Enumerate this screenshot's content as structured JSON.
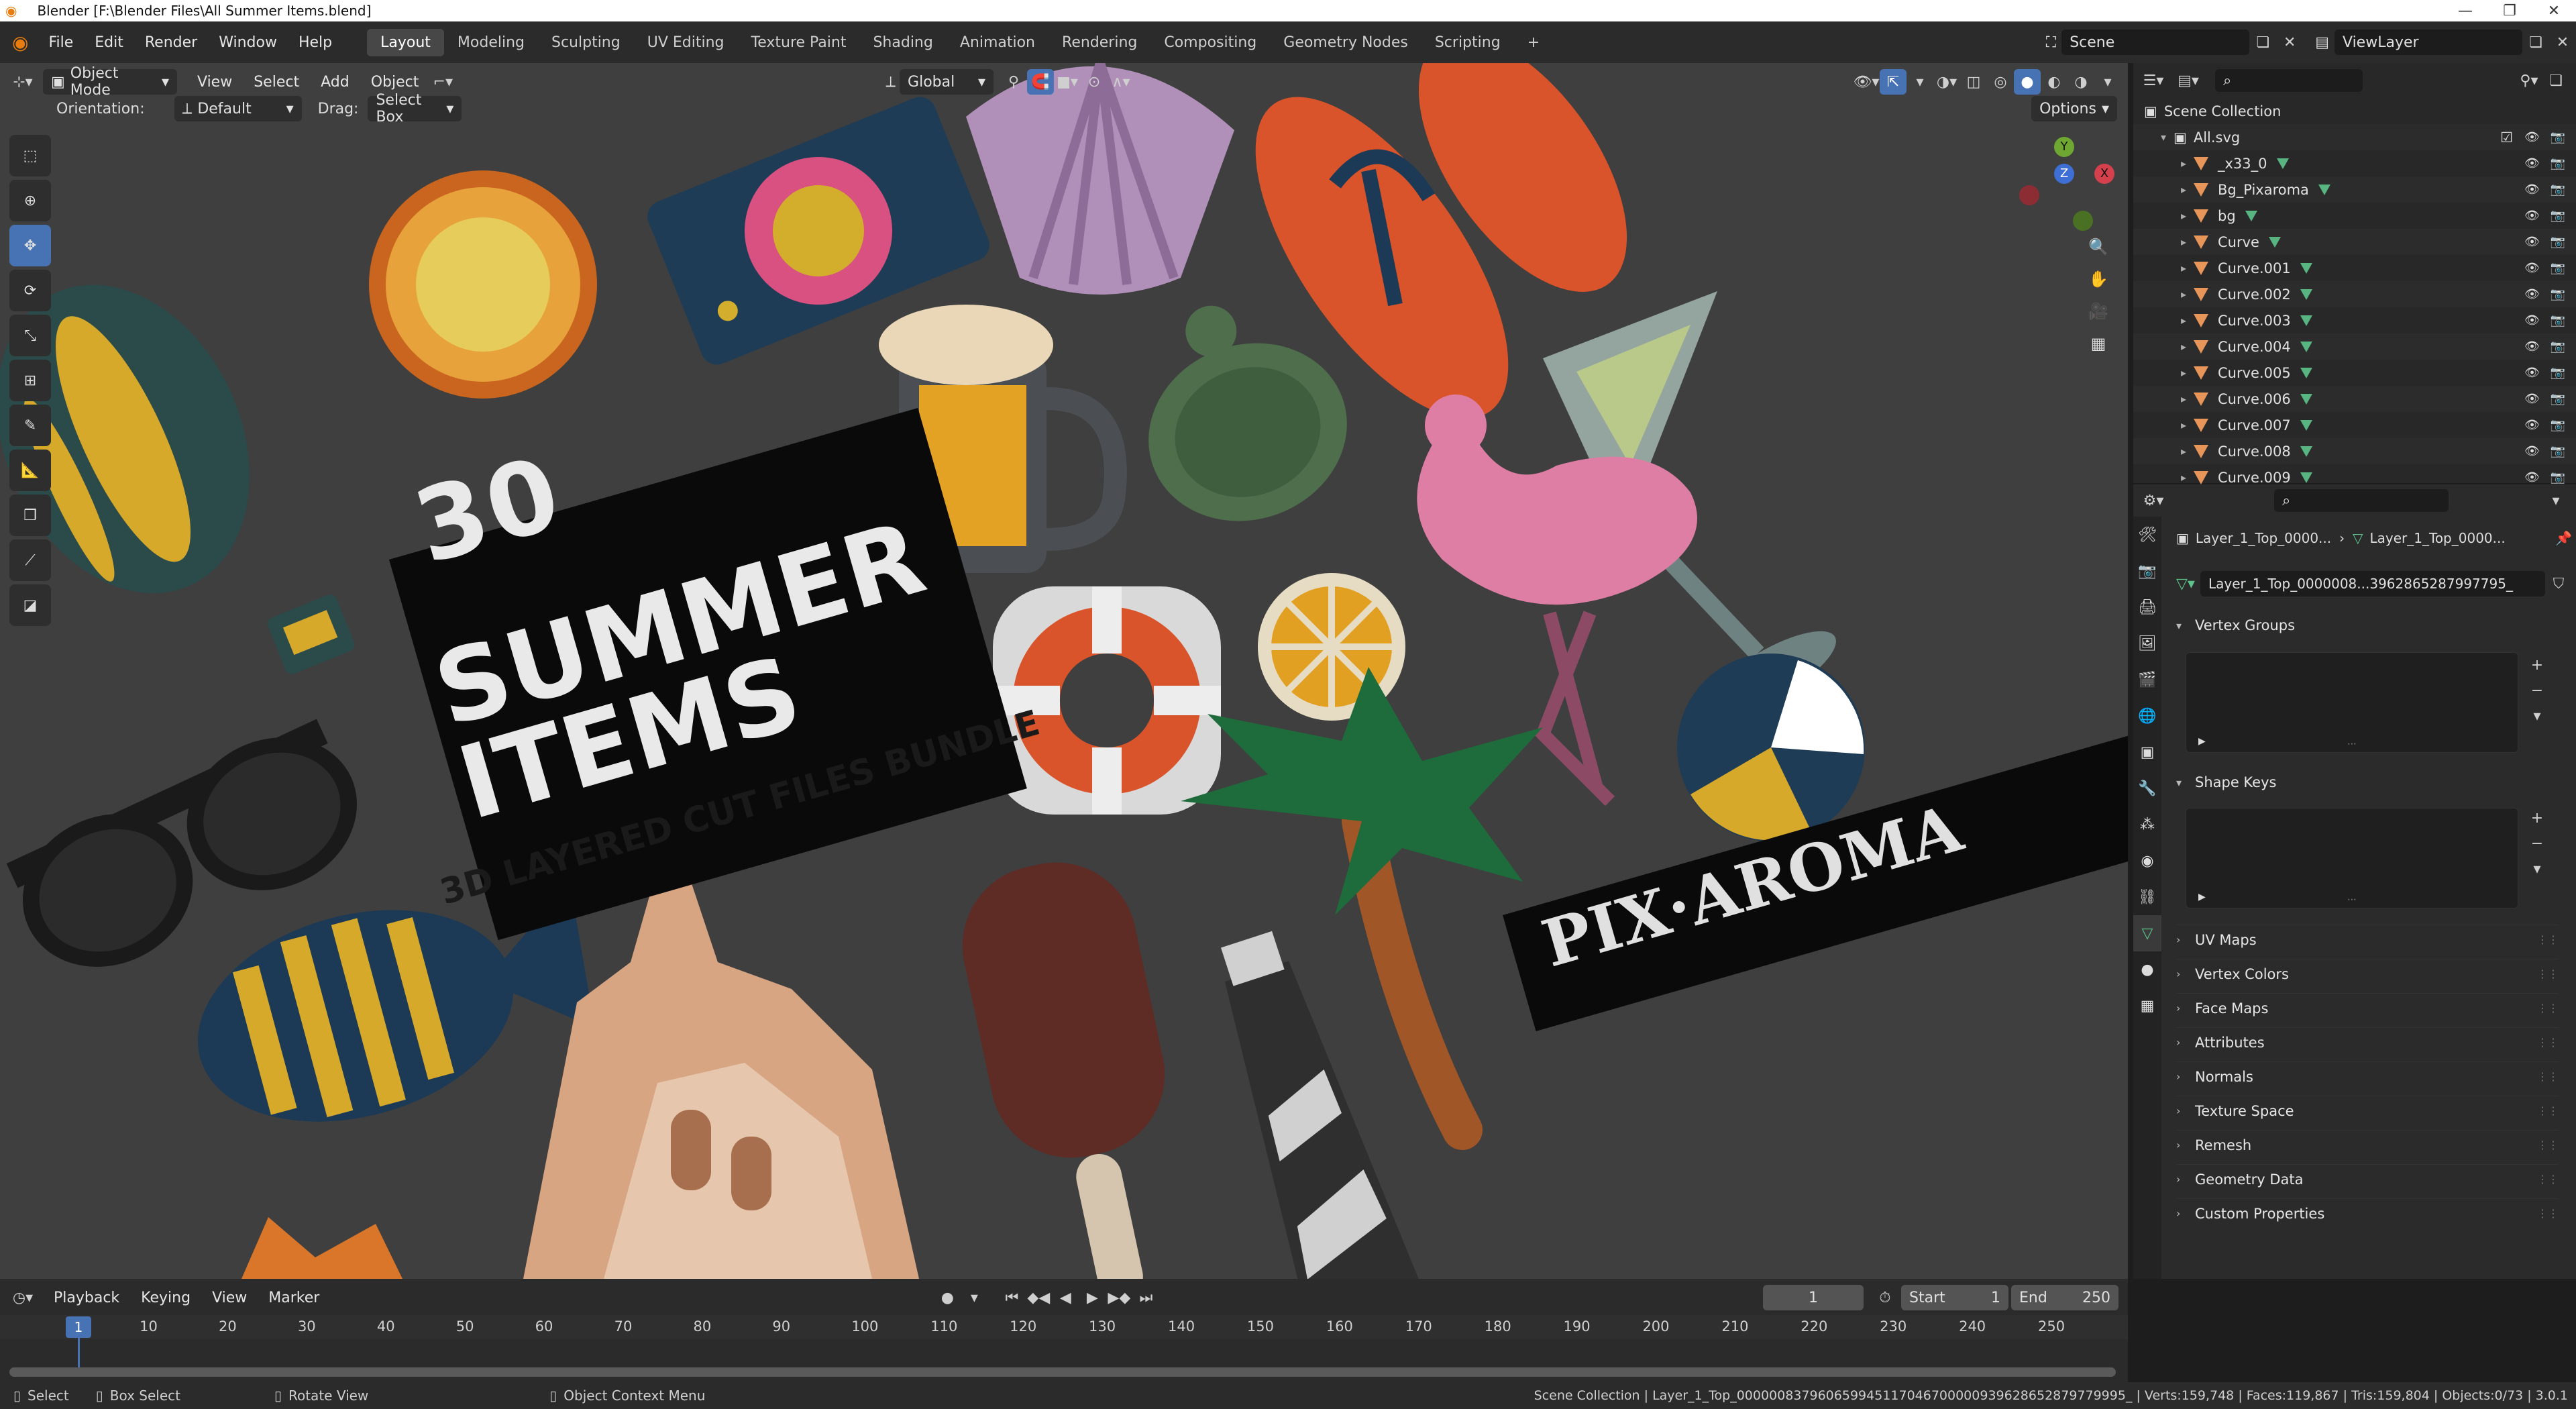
{
  "titlebar": {
    "title": "Blender [F:\\Blender Files\\All Summer Items.blend]",
    "min": "—",
    "max": "❐",
    "close": "✕"
  },
  "menu": {
    "items": [
      "File",
      "Edit",
      "Render",
      "Window",
      "Help"
    ]
  },
  "workspaces": [
    "Layout",
    "Modeling",
    "Sculpting",
    "UV Editing",
    "Texture Paint",
    "Shading",
    "Animation",
    "Rendering",
    "Compositing",
    "Geometry Nodes",
    "Scripting"
  ],
  "workspaces_active": "Layout",
  "scene": {
    "name": "Scene",
    "viewlayer": "ViewLayer"
  },
  "viewport_header": {
    "mode": "Object Mode",
    "menus": [
      "View",
      "Select",
      "Add",
      "Object"
    ],
    "transform": "Global",
    "orientation_label": "Orientation:",
    "orientation_value": "Default",
    "drag_label": "Drag:",
    "drag_value": "Select Box",
    "options": "Options"
  },
  "artwork": {
    "line1": "30",
    "line2": "SUMMER",
    "line3": "ITEMS",
    "subtitle": "3D LAYERED CUT FILES BUNDLE",
    "brand": "PIX·AROMA"
  },
  "gizmo": {
    "x": "X",
    "y": "Y",
    "z": "Z"
  },
  "outliner": {
    "search_placeholder": "",
    "header": "Scene Collection",
    "collection": "All.svg",
    "objects": [
      "_x33_0",
      "Bg_Pixaroma",
      "bg",
      "Curve",
      "Curve.001",
      "Curve.002",
      "Curve.003",
      "Curve.004",
      "Curve.005",
      "Curve.006",
      "Curve.007",
      "Curve.008",
      "Curve.009"
    ]
  },
  "properties": {
    "breadcrumb_obj": "Layer_1_Top_0000...",
    "breadcrumb_mesh": "Layer_1_Top_0000...",
    "mesh_name": "Layer_1_Top_0000008...3962865287997795_",
    "panels_open": [
      "Vertex Groups",
      "Shape Keys"
    ],
    "panels_closed": [
      "UV Maps",
      "Vertex Colors",
      "Face Maps",
      "Attributes",
      "Normals",
      "Texture Space",
      "Remesh",
      "Geometry Data",
      "Custom Properties"
    ]
  },
  "timeline": {
    "menus": [
      "Playback",
      "Keying",
      "View",
      "Marker"
    ],
    "current_frame": "1",
    "start_label": "Start",
    "start": "1",
    "end_label": "End",
    "end": "250",
    "ticks": [
      "1",
      "10",
      "20",
      "30",
      "40",
      "50",
      "60",
      "70",
      "80",
      "90",
      "100",
      "110",
      "120",
      "130",
      "140",
      "150",
      "160",
      "170",
      "180",
      "190",
      "200",
      "210",
      "220",
      "230",
      "240",
      "250"
    ]
  },
  "status": {
    "select": "Select",
    "box_select": "Box Select",
    "rotate_view": "Rotate View",
    "context_menu": "Object Context Menu",
    "info": "Scene Collection | Layer_1_Top_000000837960659945117046700000939628652879779995_ | Verts:159,748 | Faces:119,867 | Tris:159,804 | Objects:0/73 | 3.0.1"
  }
}
